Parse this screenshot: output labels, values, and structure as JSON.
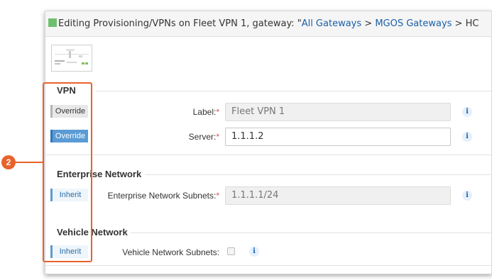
{
  "title": {
    "prefix": "Editing Provisioning/VPNs on Fleet VPN 1, gateway: \"",
    "crumb_all": "All Gateways",
    "sep1": " > ",
    "crumb_mgos": "MGOS Gateways",
    "sep2": " > HC"
  },
  "sections": {
    "vpn": "VPN",
    "enterprise": "Enterprise Network",
    "vehicle": "Vehicle Network"
  },
  "rows": {
    "label": {
      "button": "Override",
      "label": "Label:",
      "value": "Fleet VPN 1"
    },
    "server": {
      "button": "Override",
      "label": "Server:",
      "value": "1.1.1.2"
    },
    "enterprise_subnets": {
      "button": "Inherit",
      "label": "Enterprise Network Subnets:",
      "value": "1.1.1.1/24"
    },
    "vehicle_subnets": {
      "button": "Inherit",
      "label": "Vehicle Network Subnets:"
    }
  },
  "required_mark": "*",
  "info_glyph": "i",
  "callout": {
    "number": "2"
  },
  "colors": {
    "accent": "#e8622b",
    "override_active": "#5b9bd5",
    "link": "#1a5fa8"
  }
}
